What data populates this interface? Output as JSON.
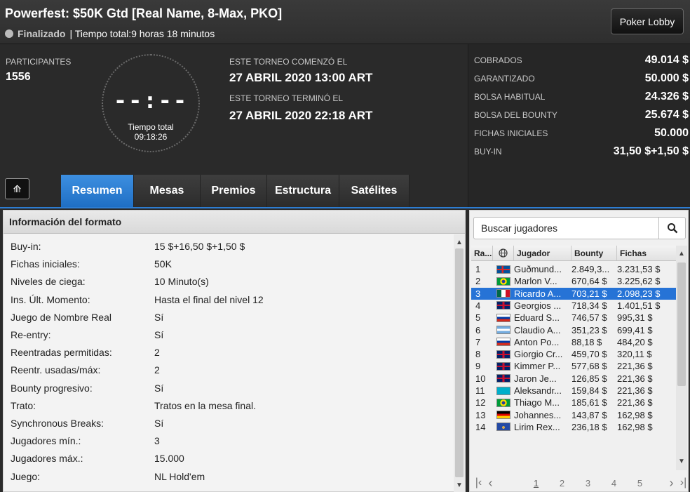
{
  "header": {
    "title": "Powerfest: $50K Gtd [Real Name, 8-Max, PKO]",
    "status": "Finalizado",
    "total_time_text": "| Tiempo total:9 horas  18 minutos",
    "lobby_button": "Poker Lobby"
  },
  "summary": {
    "participants_label": "PARTICIPANTES",
    "participants_value": "1556",
    "clock_digits": "--:--",
    "clock_caption": "Tiempo total",
    "clock_time": "09:18:26",
    "started_label": "ESTE TORNEO COMENZó EL",
    "started_value": "27 ABRIL 2020  13:00 ART",
    "ended_label": "ESTE TORNEO TERMINó EL",
    "ended_value": "27 ABRIL 2020  22:18 ART"
  },
  "stats": [
    {
      "label": "COBRADOS",
      "value": "49.014 $"
    },
    {
      "label": "GARANTIZADO",
      "value": "50.000 $"
    },
    {
      "label": "BOLSA HABITUAL",
      "value": "24.326 $"
    },
    {
      "label": "BOLSA DEL BOUNTY",
      "value": "25.674 $"
    },
    {
      "label": "FICHAS INICIALES",
      "value": "50.000"
    },
    {
      "label": "BUY-IN",
      "value": "31,50 $+1,50 $"
    }
  ],
  "tabs": [
    "Resumen",
    "Mesas",
    "Premios",
    "Estructura",
    "Satélites"
  ],
  "active_tab": "Resumen",
  "format": {
    "title": "Información del formato",
    "rows": [
      {
        "k": "Buy-in:",
        "v": "15 $+16,50 $+1,50 $"
      },
      {
        "k": "Fichas iniciales:",
        "v": "50K"
      },
      {
        "k": "Niveles de ciega:",
        "v": "10 Minuto(s)"
      },
      {
        "k": "Ins. Últ. Momento:",
        "v": "Hasta el final del nivel 12"
      },
      {
        "k": "Juego de Nombre Real",
        "v": "Sí"
      },
      {
        "k": "Re-entry:",
        "v": "Sí"
      },
      {
        "k": "Reentradas permitidas:",
        "v": "2"
      },
      {
        "k": "Reentr. usadas/máx:",
        "v": "2"
      },
      {
        "k": "Bounty progresivo:",
        "v": "Sí"
      },
      {
        "k": "Trato:",
        "v": "Tratos en la mesa final."
      },
      {
        "k": "Synchronous Breaks:",
        "v": "Sí"
      },
      {
        "k": "Jugadores mín.:",
        "v": "3"
      },
      {
        "k": "Jugadores máx.:",
        "v": "15.000"
      },
      {
        "k": "Juego:",
        "v": "NL Hold'em"
      }
    ]
  },
  "players": {
    "search_placeholder": "Buscar jugadores",
    "columns": {
      "rank": "Ra...",
      "player": "Jugador",
      "bounty": "Bounty",
      "chips": "Fichas"
    },
    "rows": [
      {
        "rank": "1",
        "flag": "iceland",
        "name": "Guðmund...",
        "bounty": "2.849,3...",
        "chips": "3.231,53 $"
      },
      {
        "rank": "2",
        "flag": "brazil",
        "name": "Marlon V...",
        "bounty": "670,64 $",
        "chips": "3.225,62 $"
      },
      {
        "rank": "3",
        "flag": "mexico",
        "name": "Ricardo A...",
        "bounty": "703,21 $",
        "chips": "2.098,23 $"
      },
      {
        "rank": "4",
        "flag": "uk",
        "name": "Georgios ...",
        "bounty": "718,34 $",
        "chips": "1.401,51 $"
      },
      {
        "rank": "5",
        "flag": "russia",
        "name": "Eduard  S...",
        "bounty": "746,57 $",
        "chips": "995,31 $"
      },
      {
        "rank": "6",
        "flag": "argentina",
        "name": "Claudio A...",
        "bounty": "351,23 $",
        "chips": "699,41 $"
      },
      {
        "rank": "7",
        "flag": "russia",
        "name": "Anton Po...",
        "bounty": "88,18 $",
        "chips": "484,20 $"
      },
      {
        "rank": "8",
        "flag": "uk",
        "name": "Giorgio Cr...",
        "bounty": "459,70 $",
        "chips": "320,11 $"
      },
      {
        "rank": "9",
        "flag": "uk",
        "name": "Kimmer P...",
        "bounty": "577,68 $",
        "chips": "221,36 $"
      },
      {
        "rank": "10",
        "flag": "uk",
        "name": "Jaron Je...",
        "bounty": "126,85 $",
        "chips": "221,36 $"
      },
      {
        "rank": "11",
        "flag": "kazakhstan",
        "name": "Aleksandr...",
        "bounty": "159,84 $",
        "chips": "221,36 $"
      },
      {
        "rank": "12",
        "flag": "brazil",
        "name": "Thiago M...",
        "bounty": "185,61 $",
        "chips": "221,36 $"
      },
      {
        "rank": "13",
        "flag": "germany",
        "name": "Johannes...",
        "bounty": "143,87 $",
        "chips": "162,98 $"
      },
      {
        "rank": "14",
        "flag": "kosovo",
        "name": "Lirim Rex...",
        "bounty": "236,18 $",
        "chips": "162,98 $"
      }
    ],
    "selected_rank": "3",
    "pages": [
      "1",
      "2",
      "3",
      "4",
      "5"
    ],
    "current_page": "1"
  },
  "colors": {
    "accent": "#2673d6",
    "tab_active": "#2d7dd2"
  },
  "icons": {
    "collapse": "double-chevron-up-icon",
    "search": "magnifier-icon",
    "globe": "globe-icon"
  }
}
